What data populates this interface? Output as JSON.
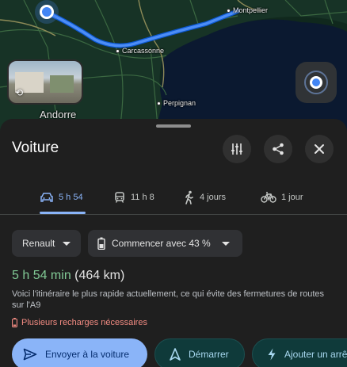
{
  "map": {
    "cities": {
      "montpellier": "Montpellier",
      "carcassonne": "Carcassonne",
      "perpignan": "Perpignan",
      "andorre": "Andorre"
    }
  },
  "sheet": {
    "title": "Voiture",
    "actions": {
      "options_icon": "tune-icon",
      "share_icon": "share-icon",
      "close_icon": "close-icon"
    },
    "modes": [
      {
        "icon": "car-icon",
        "label": "5 h 54",
        "active": true
      },
      {
        "icon": "transit-icon",
        "label": "11 h 8",
        "active": false
      },
      {
        "icon": "walk-icon",
        "label": "4 jours",
        "active": false
      },
      {
        "icon": "bike-icon",
        "label": "1 jour",
        "active": false
      }
    ],
    "chips": {
      "vehicle": "Renault",
      "battery": "Commencer avec 43 %"
    },
    "route": {
      "duration": "5 h 54 min",
      "distance": "(464 km)",
      "description": "Voici l'itinéraire le plus rapide actuellement, ce qui évite des fermetures de routes sur l'A9",
      "warning": "Plusieurs recharges nécessaires"
    },
    "buttons": {
      "send": "Envoyer à la voiture",
      "start": "Démarrer",
      "add_stop": "Ajouter un arrêt"
    }
  },
  "colors": {
    "accent": "#8ab4f8",
    "duration": "#81c995",
    "warning": "#f28b82"
  }
}
